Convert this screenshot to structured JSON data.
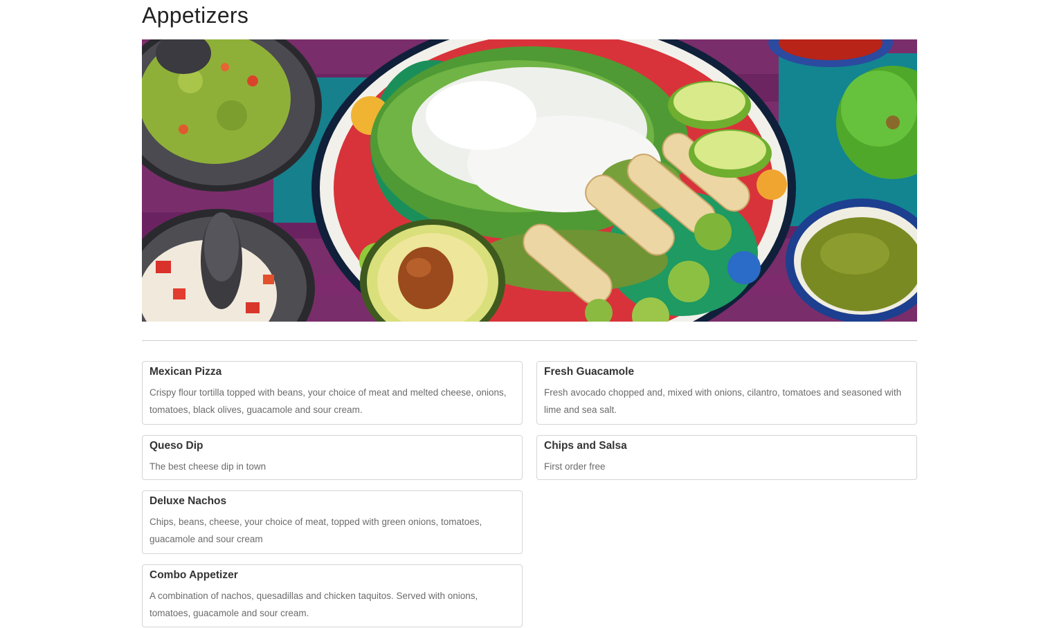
{
  "page": {
    "title": "Appetizers"
  },
  "hero": {
    "alt": "Mexican appetizers with guacamole, avocado, taquitos, limes and salsa"
  },
  "menu_items": [
    {
      "name": "Mexican Pizza",
      "description": "Crispy flour tortilla topped with beans, your choice of meat and melted cheese, onions, tomatoes, black olives, guacamole and sour cream."
    },
    {
      "name": "Fresh Guacamole",
      "description": "Fresh avocado chopped and, mixed with onions, cilantro, tomatoes and seasoned with lime and sea salt."
    },
    {
      "name": "Queso Dip",
      "description": "The best cheese dip in town"
    },
    {
      "name": "Chips and Salsa",
      "description": "First order free"
    },
    {
      "name": "Deluxe Nachos",
      "description": "Chips, beans, cheese, your choice of meat, topped with green onions, tomatoes, guacamole and sour cream"
    },
    {
      "name": "Combo Appetizer",
      "description": "A combination of nachos, quesadillas and chicken taquitos. Served with onions, tomatoes, guacamole and sour cream."
    }
  ]
}
